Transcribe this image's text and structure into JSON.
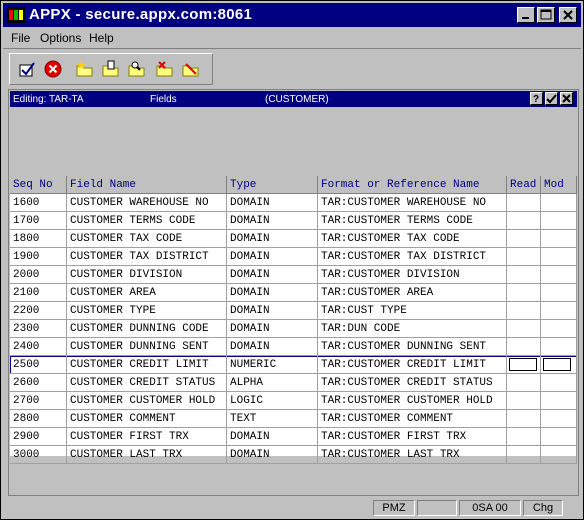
{
  "window": {
    "title": "APPX - secure.appx.com:8061"
  },
  "menu": {
    "items": [
      "File",
      "Options",
      "Help"
    ]
  },
  "toolbar": {
    "icons": [
      "ok-check-icon",
      "cancel-icon",
      "new-folder-icon",
      "edit-folder-icon",
      "find-folder-icon",
      "delete-folder-icon",
      "search-folder-icon"
    ]
  },
  "panel": {
    "editing_label": "Editing: TAR-TA",
    "section": "Fields",
    "context": "(CUSTOMER)",
    "buttons": [
      "?",
      "✓",
      "✕"
    ]
  },
  "table": {
    "columns": [
      "Seq No",
      "Field Name",
      "Type",
      "Format or Reference Name",
      "Read",
      "Mod"
    ],
    "rows": [
      {
        "seq": "1600",
        "field": "CUSTOMER WAREHOUSE NO",
        "type": "DOMAIN",
        "format": "TAR:CUSTOMER WAREHOUSE NO"
      },
      {
        "seq": "1700",
        "field": "CUSTOMER TERMS CODE",
        "type": "DOMAIN",
        "format": "TAR:CUSTOMER TERMS CODE"
      },
      {
        "seq": "1800",
        "field": "CUSTOMER TAX CODE",
        "type": "DOMAIN",
        "format": "TAR:CUSTOMER TAX CODE"
      },
      {
        "seq": "1900",
        "field": "CUSTOMER TAX DISTRICT",
        "type": "DOMAIN",
        "format": "TAR:CUSTOMER TAX DISTRICT"
      },
      {
        "seq": "2000",
        "field": "CUSTOMER DIVISION",
        "type": "DOMAIN",
        "format": "TAR:CUSTOMER DIVISION"
      },
      {
        "seq": "2100",
        "field": "CUSTOMER AREA",
        "type": "DOMAIN",
        "format": "TAR:CUSTOMER AREA"
      },
      {
        "seq": "2200",
        "field": "CUSTOMER TYPE",
        "type": "DOMAIN",
        "format": "TAR:CUST TYPE"
      },
      {
        "seq": "2300",
        "field": "CUSTOMER DUNNING CODE",
        "type": "DOMAIN",
        "format": "TAR:DUN CODE"
      },
      {
        "seq": "2400",
        "field": "CUSTOMER DUNNING SENT",
        "type": "DOMAIN",
        "format": "TAR:CUSTOMER DUNNING SENT"
      },
      {
        "seq": "2500",
        "field": "CUSTOMER CREDIT LIMIT",
        "type": "NUMERIC",
        "format": "TAR:CUSTOMER CREDIT LIMIT",
        "selected": true
      },
      {
        "seq": "2600",
        "field": "CUSTOMER CREDIT STATUS",
        "type": "ALPHA",
        "format": "TAR:CUSTOMER CREDIT STATUS"
      },
      {
        "seq": "2700",
        "field": "CUSTOMER CUSTOMER HOLD",
        "type": "LOGIC",
        "format": "TAR:CUSTOMER CUSTOMER HOLD"
      },
      {
        "seq": "2800",
        "field": "CUSTOMER COMMENT",
        "type": "TEXT",
        "format": "TAR:CUSTOMER COMMENT"
      },
      {
        "seq": "2900",
        "field": "CUSTOMER FIRST TRX",
        "type": "DOMAIN",
        "format": "TAR:CUSTOMER FIRST TRX"
      },
      {
        "seq": "3000",
        "field": "CUSTOMER LAST TRX",
        "type": "DOMAIN",
        "format": "TAR:CUSTOMER LAST TRX"
      }
    ]
  },
  "status": {
    "fields": [
      "PMZ",
      "",
      "0SA 00",
      "Chg"
    ]
  }
}
